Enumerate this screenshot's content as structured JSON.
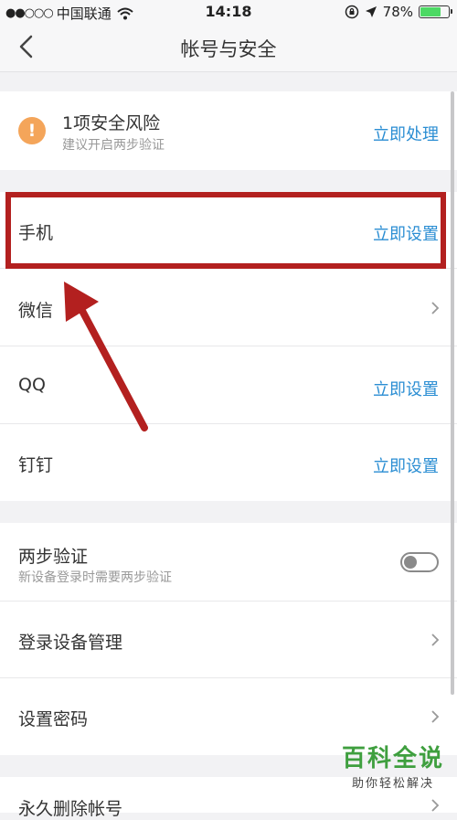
{
  "status_bar": {
    "carrier": "中国联通",
    "time": "14:18",
    "battery_percent": "78%",
    "battery_level": 0.78
  },
  "nav": {
    "title": "帐号与安全"
  },
  "risk": {
    "title": "1项安全风险",
    "subtitle": "建议开启两步验证",
    "action": "立即处理"
  },
  "accounts": [
    {
      "label": "手机",
      "action": "立即设置"
    },
    {
      "label": "微信"
    },
    {
      "label": "QQ",
      "action": "立即设置"
    },
    {
      "label": "钉钉",
      "action": "立即设置"
    }
  ],
  "security": {
    "two_step": {
      "label": "两步验证",
      "subtitle": "新设备登录时需要两步验证",
      "enabled": false
    },
    "device_mgmt": {
      "label": "登录设备管理"
    },
    "set_password": {
      "label": "设置密码"
    }
  },
  "delete_account": {
    "label": "永久删除帐号"
  },
  "watermark": {
    "title": "百科全说",
    "subtitle": "助你轻松解决"
  },
  "colors": {
    "accent": "#2b8ed3",
    "warning": "#f4a55a",
    "highlight": "#b3201f"
  }
}
